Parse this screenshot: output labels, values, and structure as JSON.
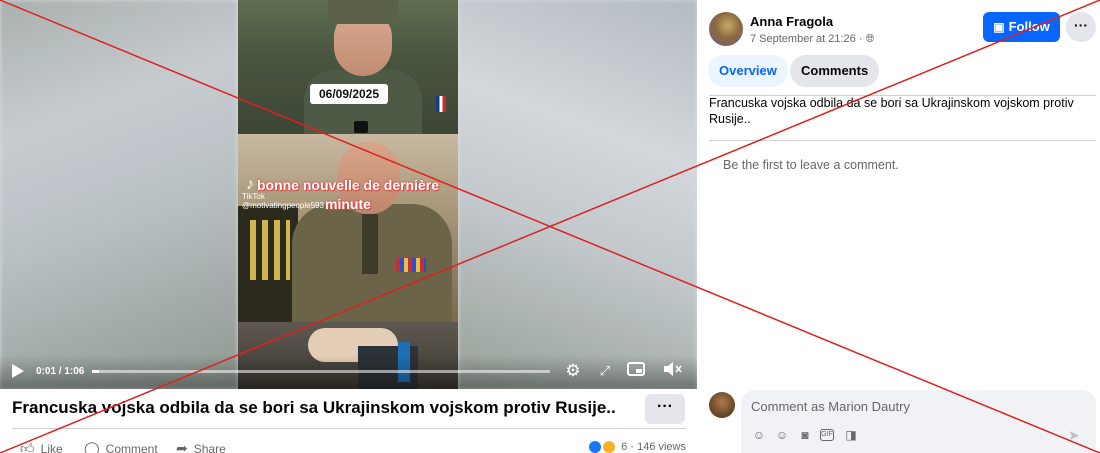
{
  "video": {
    "date_overlay": "06/09/2025",
    "caption_overlay_line1": "bonne nouvelle de dernière",
    "caption_overlay_line2": "minute",
    "watermark_brand": "TikTok",
    "watermark_handle": "@motivatingpeople593",
    "time": "0:01 / 1:06",
    "progress": 0.015,
    "icons": [
      "play-icon",
      "settings-icon",
      "fullscreen-icon",
      "pip-icon",
      "mute-icon"
    ]
  },
  "post": {
    "title": "Francuska vojska odbila da se bori sa Ukrajinskom vojskom protiv Rusije..",
    "more_label": "···",
    "like_label": "Like",
    "comment_label": "Comment",
    "share_label": "Share",
    "reactions_count": "6",
    "views": "146 views"
  },
  "sidebar": {
    "author": "Anna Fragola",
    "timestamp": "7 September at 21:26 ·",
    "follow_label": "Follow",
    "more_label": "···",
    "tabs": [
      {
        "label": "Overview"
      },
      {
        "label": "Comments"
      }
    ],
    "post_text": "Francuska vojska odbila da se bori sa Ukrajinskom vojskom protiv Rusije..",
    "empty_state": "Be the first to leave a comment.",
    "comment_placeholder": "Comment as Marion Dautry"
  },
  "colors": {
    "accent": "#0866ff",
    "cross": "#e02020"
  }
}
